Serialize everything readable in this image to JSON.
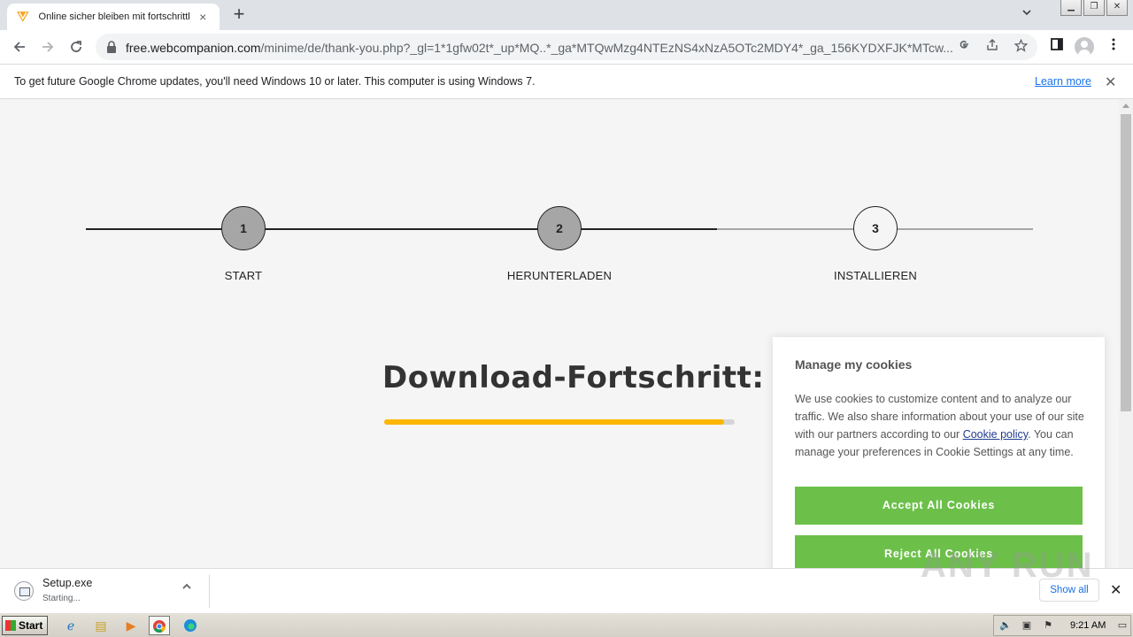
{
  "browser": {
    "tab": {
      "title": "Online sicher bleiben mit fortschrittlichem Schutz",
      "close_icon": "×"
    },
    "new_tab_icon": "+",
    "url": {
      "host": "free.webcompanion.com",
      "path": "/minime/de/thank-you.php?_gl=1*1gfw02t*_up*MQ..*_ga*MTQwMzg4NTEzNS4xNzA5OTc2MDY4*_ga_156KYDXFJK*MTcw..."
    },
    "infobar": {
      "message": "To get future Google Chrome updates, you'll need Windows 10 or later. This computer is using Windows 7.",
      "link": "Learn more"
    }
  },
  "steps": [
    {
      "number": "1",
      "label": "START",
      "done": true
    },
    {
      "number": "2",
      "label": "HERUNTERLADEN",
      "done": true
    },
    {
      "number": "3",
      "label": "INSTALLIEREN",
      "done": false
    }
  ],
  "colors": {
    "step_done": "#a6a6a6",
    "step_pending": "#f5f5f5",
    "progress": "#fbb600",
    "cookie_button": "#6cc04a"
  },
  "download_section": {
    "heading": "Download-Fortschritt:",
    "progress_percent": 97
  },
  "cookie_panel": {
    "title": "Manage my cookies",
    "text_before_link": "We use cookies to customize content and to analyze our traffic. We also share information about your use of our site with our partners according to our ",
    "link": "Cookie policy",
    "text_after_link": ". You can manage your preferences in Cookie Settings at any time.",
    "accept_button": "Accept All Cookies",
    "reject_button": "Reject All Cookies"
  },
  "download_shelf": {
    "file_name": "Setup.exe",
    "status": "Starting...",
    "show_all": "Show all",
    "watermark": "ANY RUN"
  },
  "taskbar": {
    "start_label": "Start",
    "clock": "9:21 AM"
  }
}
